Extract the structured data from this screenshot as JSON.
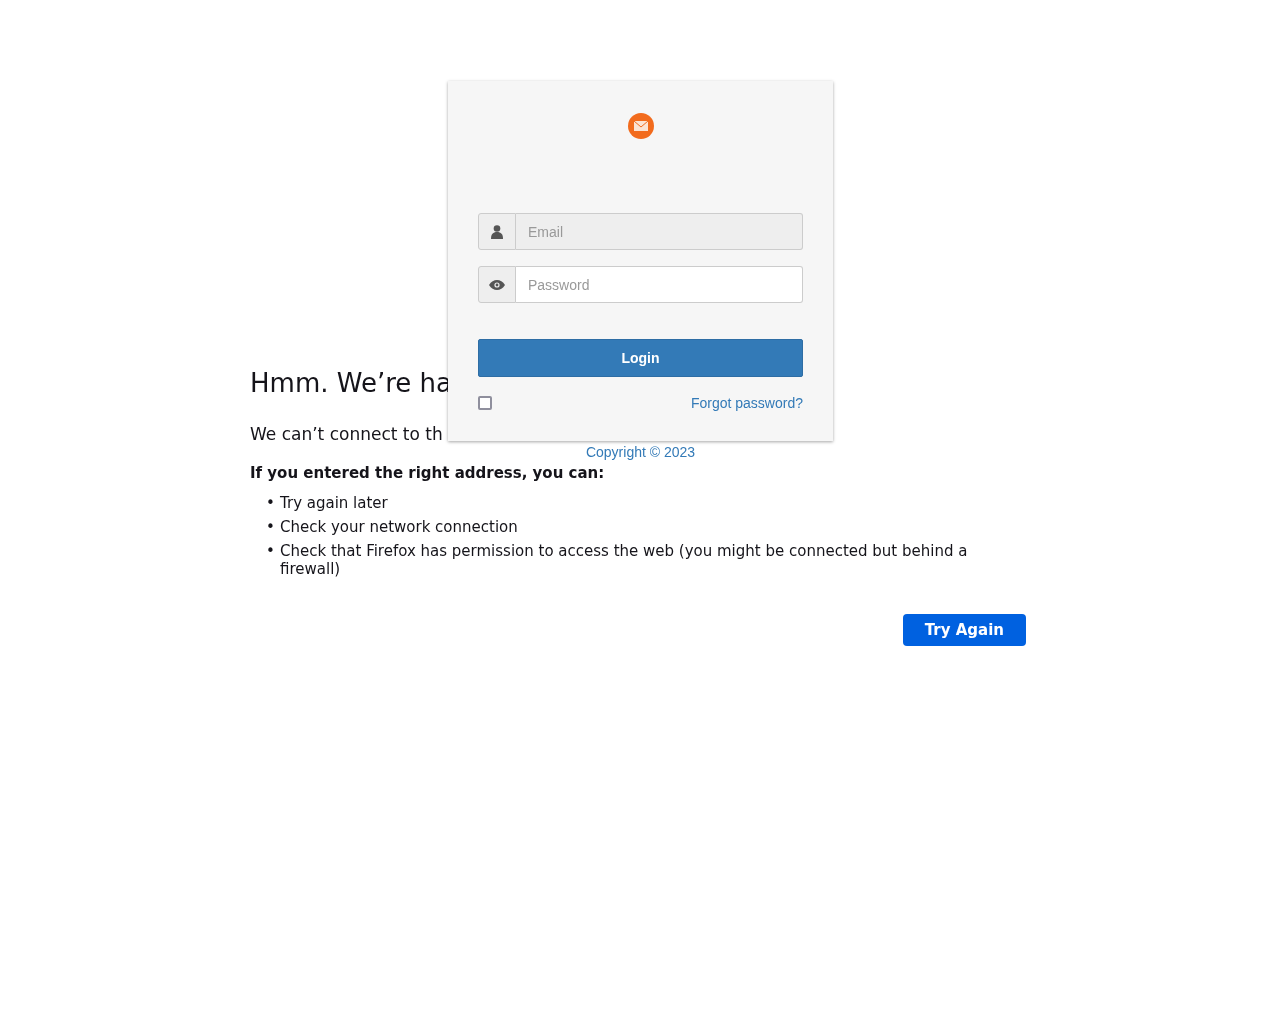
{
  "error_page": {
    "heading": "Hmm. We’re ha",
    "intro": "We can’t connect to th",
    "suggestion_title": "If you entered the right address, you can:",
    "suggestions": [
      {
        "marker": "•",
        "text": "Try again later"
      },
      {
        "marker": "•",
        "text": "Check your network connection"
      },
      {
        "marker": "•",
        "text": "Check that Firefox has permission to access the web (you might be connected but behind a firewall)"
      }
    ],
    "button": "Try Again"
  },
  "login": {
    "fields": [
      {
        "kind": "user",
        "placeholder": "Email",
        "disabled": true
      },
      {
        "kind": "eye",
        "placeholder": "Password",
        "disabled": false
      }
    ],
    "button": "Login",
    "remember": {
      "checked": false
    },
    "forgot_link": "Forgot password?",
    "copyright": "Copyright © 2023"
  }
}
